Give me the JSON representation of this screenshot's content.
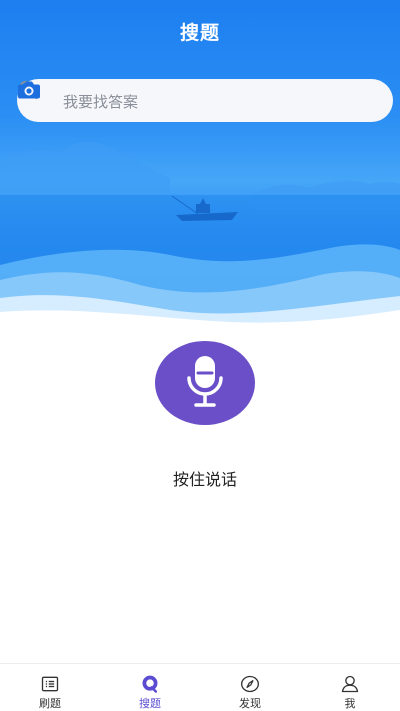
{
  "header": {
    "title": "搜题"
  },
  "search": {
    "placeholder": "我要找答案",
    "value": ""
  },
  "voice": {
    "hint": "按住说话"
  },
  "tabs": [
    {
      "label": "刷题",
      "icon": "list-icon",
      "active": false
    },
    {
      "label": "搜题",
      "icon": "search-tab-icon",
      "active": true
    },
    {
      "label": "发现",
      "icon": "compass-icon",
      "active": false
    },
    {
      "label": "我",
      "icon": "user-icon",
      "active": false
    }
  ],
  "colors": {
    "header_blue": "#1d7ff0",
    "mic_purple": "#6a4fc8",
    "active_tab": "#5b4cd2"
  }
}
